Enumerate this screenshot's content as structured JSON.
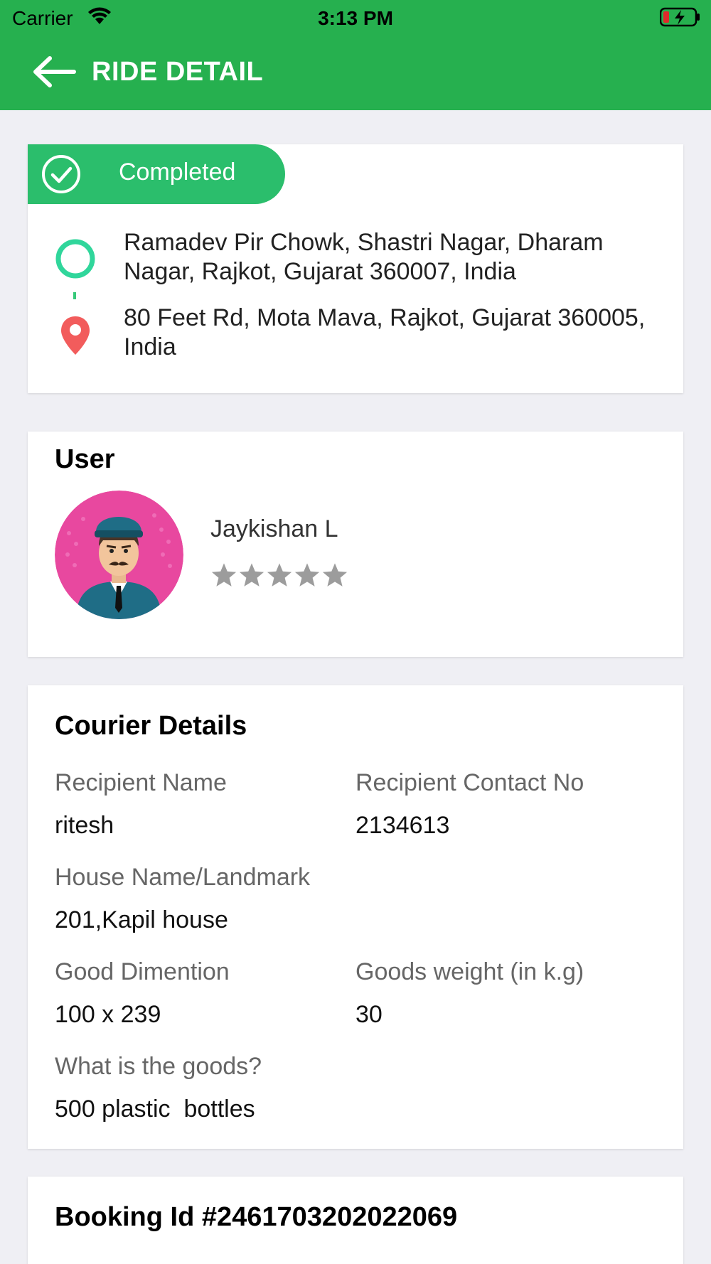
{
  "status_bar": {
    "carrier": "Carrier",
    "time": "3:13 PM"
  },
  "header": {
    "title": "RIDE DETAIL",
    "back_icon": "arrow-left-icon",
    "background": "#26b04f"
  },
  "ride": {
    "status": "Completed",
    "status_color": "#2bbe6c",
    "pickup_address": "Ramadev Pir Chowk, Shastri Nagar, Dharam Nagar, Rajkot, Gujarat 360007, India",
    "drop_address": "80 Feet Rd, Mota Mava, Rajkot, Gujarat 360005, India"
  },
  "user": {
    "section_title": "User",
    "name": "Jaykishan L",
    "rating": 0,
    "rating_max": 5
  },
  "courier": {
    "section_title": "Courier Details",
    "recipient_name_label": "Recipient Name",
    "recipient_name": "ritesh",
    "recipient_contact_label": "Recipient Contact No",
    "recipient_contact": "2134613",
    "house_label": "House Name/Landmark",
    "house": "201,Kapil house",
    "dimension_label": "Good Dimention",
    "dimension": "100 x 239",
    "weight_label": "Goods weight (in k.g)",
    "weight": "30",
    "goods_label": "What is the goods?",
    "goods": "500 plastic  bottles"
  },
  "booking": {
    "id_text": "Booking Id #2461703202022069"
  }
}
